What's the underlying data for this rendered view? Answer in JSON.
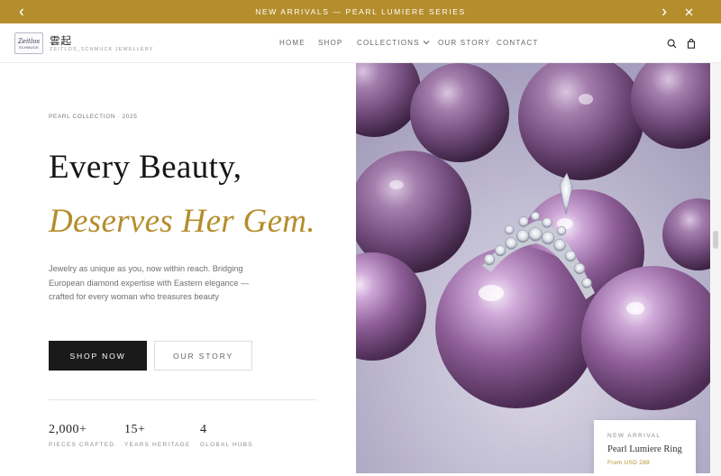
{
  "announcement": {
    "text": "NEW ARRIVALS — PEARL LUMIERE SERIES",
    "prev_icon": "chevron-left-icon",
    "next_icon": "chevron-right-icon",
    "close_icon": "close-icon"
  },
  "header": {
    "logo_mark_line1": "Zeitlos",
    "logo_mark_line2": "SCHMUCK",
    "logo_cn": "雲起",
    "logo_sub": "ZEITLOS_SCHMUCK JEWELLERY",
    "nav": [
      "HOME",
      "SHOP",
      "COLLECTIONS",
      "OUR STORY",
      "CONTACT"
    ],
    "search_icon": "search-icon",
    "bag_icon": "shopping-bag-icon"
  },
  "hero": {
    "eyebrow": "PEARL COLLECTION · 2025",
    "title_line1": "Every Beauty,",
    "title_line2": "Deserves Her Gem.",
    "description": "Jewelry as unique as you, now within reach. Bridging European diamond expertise with Eastern elegance — crafted for every woman who treasures beauty",
    "cta_primary": "SHOP NOW",
    "cta_secondary": "OUR STORY",
    "stats": [
      {
        "value": "2,000+",
        "label": "PIECES CRAFTED"
      },
      {
        "value": "15+",
        "label": "YEARS HERITAGE"
      },
      {
        "value": "4",
        "label": "GLOBAL HUBS"
      }
    ]
  },
  "product_card": {
    "tag": "NEW ARRIVAL",
    "name": "Pearl Lumiere Ring",
    "price": "From USD 288"
  },
  "colors": {
    "accent_gold": "#b48d2c",
    "dark": "#1a1a1a",
    "pearl": "#a07ab4"
  }
}
